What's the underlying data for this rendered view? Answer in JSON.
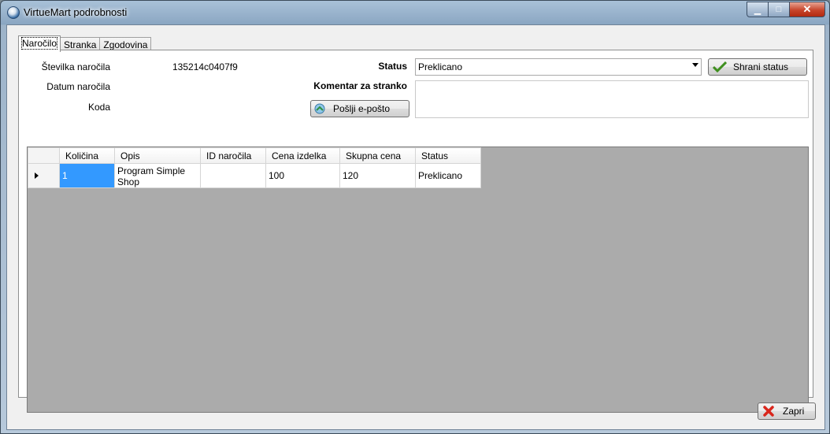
{
  "window": {
    "title": "VirtueMart podrobnosti",
    "minimize_glyph": "▁",
    "maximize_glyph": "□",
    "close_glyph": "✕"
  },
  "tabs": [
    {
      "label": "Naročilo",
      "active": true
    },
    {
      "label": "Stranka",
      "active": false
    },
    {
      "label": "Zgodovina",
      "active": false
    }
  ],
  "order": {
    "number_label": "Številka naročila",
    "number_value": "135214c0407f9",
    "date_label": "Datum naročila",
    "code_label": "Koda"
  },
  "status": {
    "label": "Status",
    "selected": "Preklicano",
    "save_button": "Shrani status"
  },
  "comment": {
    "label": "Komentar za stranko",
    "value": ""
  },
  "send_email_button": "Pošlji e-pošto",
  "grid": {
    "columns": [
      "Količina",
      "Opis",
      "ID naročila",
      "Cena izdelka",
      "Skupna cena",
      "Status"
    ],
    "rows": [
      [
        "1",
        "Program Simple Shop",
        "",
        "100",
        "120",
        "Preklicano"
      ]
    ]
  },
  "close_button": "Zapri",
  "colors": {
    "selection": "#3399ff",
    "grid_background": "#ababab"
  },
  "icons": {
    "app": "app-globe-icon",
    "save": "checkmark-icon",
    "email": "email-send-icon",
    "close": "red-x-icon"
  }
}
